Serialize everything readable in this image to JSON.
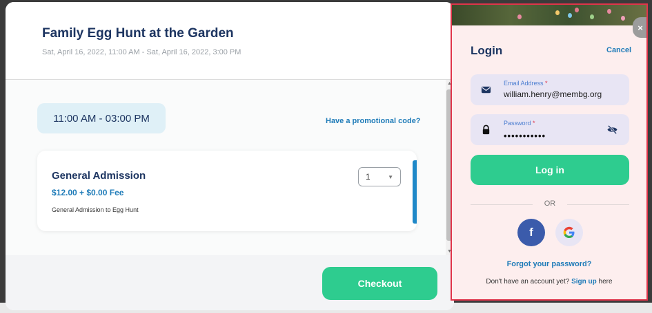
{
  "event": {
    "title": "Family Egg Hunt at the Garden",
    "date_range": "Sat, April 16, 2022, 11:00 AM - Sat, April 16, 2022, 3:00 PM",
    "time_slot": "11:00 AM - 03:00 PM",
    "promo_link": "Have a promotional code?"
  },
  "ticket": {
    "name": "General Admission",
    "price": "$12.00  + $0.00 Fee",
    "description": "General Admission to Egg Hunt",
    "quantity": "1"
  },
  "checkout_label": "Checkout",
  "login": {
    "title": "Login",
    "cancel": "Cancel",
    "close": "×",
    "email_label": "Email Address",
    "email_value": "william.henry@membg.org",
    "password_label": "Password",
    "password_value": "•••••••••••",
    "required_mark": "*",
    "login_button": "Log in",
    "or_text": "OR",
    "facebook_glyph": "f",
    "forgot_password": "Forgot your password?",
    "no_account_text": "Don't have an account yet?",
    "signup_link": "Sign up",
    "signup_suffix": "here"
  },
  "colors": {
    "primary_green": "#2ecc8f",
    "navy": "#1d3561",
    "link_blue": "#1e7bb8",
    "highlight_red": "#e0344a"
  }
}
